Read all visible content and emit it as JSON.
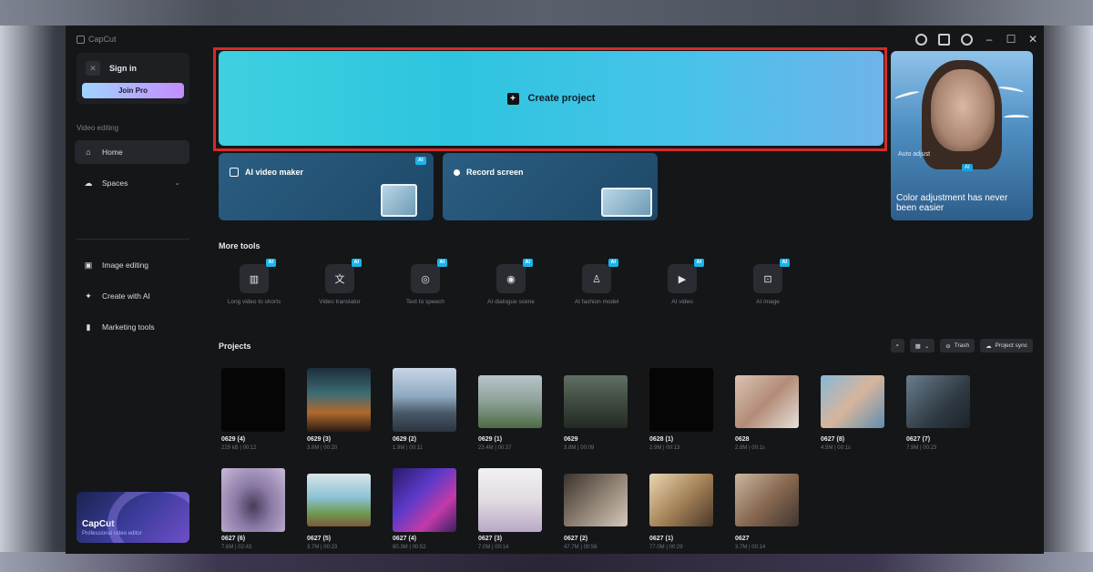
{
  "app": {
    "name": "CapCut"
  },
  "sidebar": {
    "sign_in": "Sign in",
    "join_pro": "Join Pro",
    "section_label": "Video editing",
    "items": [
      {
        "label": "Home",
        "icon": "home-icon"
      },
      {
        "label": "Spaces",
        "icon": "cloud-icon"
      },
      {
        "label": "Image editing",
        "icon": "image-icon"
      },
      {
        "label": "Create with AI",
        "icon": "sparkle-icon"
      },
      {
        "label": "Marketing tools",
        "icon": "bag-icon"
      }
    ],
    "promo": {
      "title": "CapCut",
      "subtitle": "Professional video editor"
    }
  },
  "main": {
    "create_project": "Create project",
    "hero": {
      "tag": "Auto adjust",
      "text": "Color adjustment has never been easier",
      "badge": "AI"
    },
    "features": [
      {
        "label": "AI video maker",
        "badge": "AI"
      },
      {
        "label": "Record screen",
        "badge": ""
      }
    ],
    "more_tools_title": "More tools",
    "tools": [
      {
        "label": "Long video to shorts",
        "icon": "split-icon",
        "badge": "AI"
      },
      {
        "label": "Video translator",
        "icon": "translate-icon",
        "badge": "AI"
      },
      {
        "label": "Text to speech",
        "icon": "speech-icon",
        "badge": "AI"
      },
      {
        "label": "AI dialogue scene",
        "icon": "dialogue-icon",
        "badge": "AI"
      },
      {
        "label": "AI fashion model",
        "icon": "shirt-icon",
        "badge": "AI"
      },
      {
        "label": "AI video",
        "icon": "video-icon",
        "badge": "AI"
      },
      {
        "label": "AI image",
        "icon": "image-gen-icon",
        "badge": "AI"
      }
    ],
    "projects_title": "Projects",
    "project_actions": {
      "trash": "Trash",
      "sync": "Project sync"
    },
    "projects": [
      {
        "name": "0629 (4)",
        "meta": "229 kB | 00:12"
      },
      {
        "name": "0629 (3)",
        "meta": "3.6M | 00:20"
      },
      {
        "name": "0629 (2)",
        "meta": "1.9M | 00:11"
      },
      {
        "name": "0629 (1)",
        "meta": "23.4M | 00:37"
      },
      {
        "name": "0629",
        "meta": "3.8M | 00:09"
      },
      {
        "name": "0628 (1)",
        "meta": "2.9M | 00:13"
      },
      {
        "name": "0628",
        "meta": "2.8M | 00:1s"
      },
      {
        "name": "0627 (8)",
        "meta": "4.5M | 00:1s"
      },
      {
        "name": "0627 (7)",
        "meta": "7.9M | 00:23"
      },
      {
        "name": "0627 (6)",
        "meta": "7.6M | 02:43"
      },
      {
        "name": "0627 (5)",
        "meta": "3.7M | 00:23"
      },
      {
        "name": "0627 (4)",
        "meta": "80.3M | 00:52"
      },
      {
        "name": "0627 (3)",
        "meta": "7.0M | 00:14"
      },
      {
        "name": "0627 (2)",
        "meta": "47.7M | 00:56"
      },
      {
        "name": "0627 (1)",
        "meta": "77.0M | 00:29"
      },
      {
        "name": "0627",
        "meta": "3.7M | 00:14"
      }
    ]
  }
}
